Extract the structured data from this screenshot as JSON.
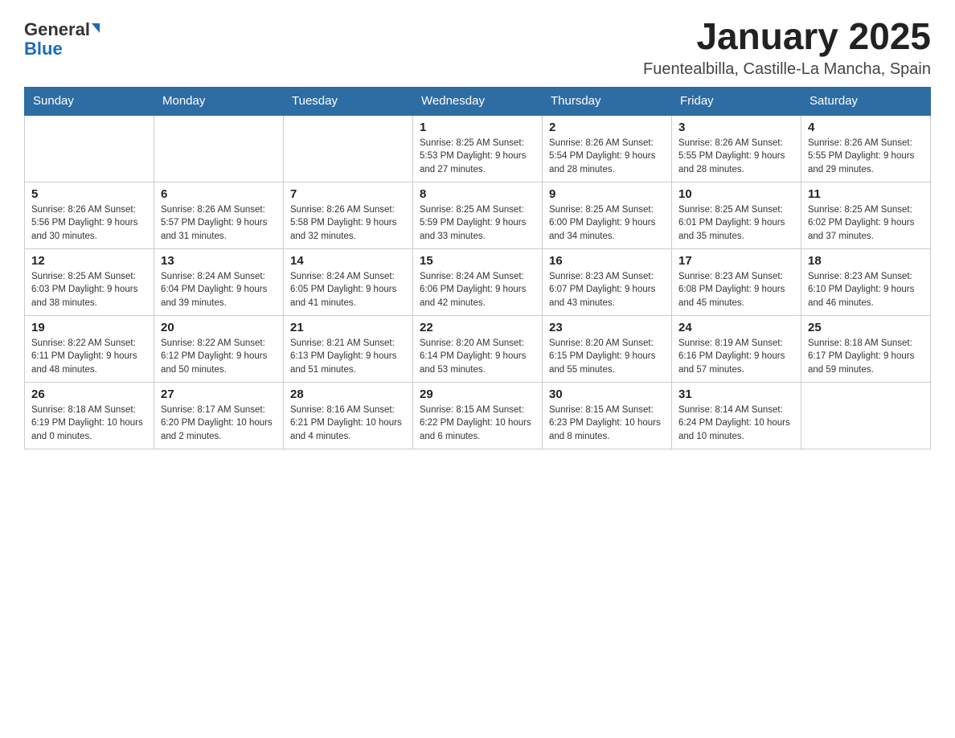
{
  "header": {
    "logo_text": "General",
    "logo_blue": "Blue",
    "title": "January 2025",
    "subtitle": "Fuentealbilla, Castille-La Mancha, Spain"
  },
  "days_of_week": [
    "Sunday",
    "Monday",
    "Tuesday",
    "Wednesday",
    "Thursday",
    "Friday",
    "Saturday"
  ],
  "weeks": [
    [
      {
        "day": "",
        "info": ""
      },
      {
        "day": "",
        "info": ""
      },
      {
        "day": "",
        "info": ""
      },
      {
        "day": "1",
        "info": "Sunrise: 8:25 AM\nSunset: 5:53 PM\nDaylight: 9 hours\nand 27 minutes."
      },
      {
        "day": "2",
        "info": "Sunrise: 8:26 AM\nSunset: 5:54 PM\nDaylight: 9 hours\nand 28 minutes."
      },
      {
        "day": "3",
        "info": "Sunrise: 8:26 AM\nSunset: 5:55 PM\nDaylight: 9 hours\nand 28 minutes."
      },
      {
        "day": "4",
        "info": "Sunrise: 8:26 AM\nSunset: 5:55 PM\nDaylight: 9 hours\nand 29 minutes."
      }
    ],
    [
      {
        "day": "5",
        "info": "Sunrise: 8:26 AM\nSunset: 5:56 PM\nDaylight: 9 hours\nand 30 minutes."
      },
      {
        "day": "6",
        "info": "Sunrise: 8:26 AM\nSunset: 5:57 PM\nDaylight: 9 hours\nand 31 minutes."
      },
      {
        "day": "7",
        "info": "Sunrise: 8:26 AM\nSunset: 5:58 PM\nDaylight: 9 hours\nand 32 minutes."
      },
      {
        "day": "8",
        "info": "Sunrise: 8:25 AM\nSunset: 5:59 PM\nDaylight: 9 hours\nand 33 minutes."
      },
      {
        "day": "9",
        "info": "Sunrise: 8:25 AM\nSunset: 6:00 PM\nDaylight: 9 hours\nand 34 minutes."
      },
      {
        "day": "10",
        "info": "Sunrise: 8:25 AM\nSunset: 6:01 PM\nDaylight: 9 hours\nand 35 minutes."
      },
      {
        "day": "11",
        "info": "Sunrise: 8:25 AM\nSunset: 6:02 PM\nDaylight: 9 hours\nand 37 minutes."
      }
    ],
    [
      {
        "day": "12",
        "info": "Sunrise: 8:25 AM\nSunset: 6:03 PM\nDaylight: 9 hours\nand 38 minutes."
      },
      {
        "day": "13",
        "info": "Sunrise: 8:24 AM\nSunset: 6:04 PM\nDaylight: 9 hours\nand 39 minutes."
      },
      {
        "day": "14",
        "info": "Sunrise: 8:24 AM\nSunset: 6:05 PM\nDaylight: 9 hours\nand 41 minutes."
      },
      {
        "day": "15",
        "info": "Sunrise: 8:24 AM\nSunset: 6:06 PM\nDaylight: 9 hours\nand 42 minutes."
      },
      {
        "day": "16",
        "info": "Sunrise: 8:23 AM\nSunset: 6:07 PM\nDaylight: 9 hours\nand 43 minutes."
      },
      {
        "day": "17",
        "info": "Sunrise: 8:23 AM\nSunset: 6:08 PM\nDaylight: 9 hours\nand 45 minutes."
      },
      {
        "day": "18",
        "info": "Sunrise: 8:23 AM\nSunset: 6:10 PM\nDaylight: 9 hours\nand 46 minutes."
      }
    ],
    [
      {
        "day": "19",
        "info": "Sunrise: 8:22 AM\nSunset: 6:11 PM\nDaylight: 9 hours\nand 48 minutes."
      },
      {
        "day": "20",
        "info": "Sunrise: 8:22 AM\nSunset: 6:12 PM\nDaylight: 9 hours\nand 50 minutes."
      },
      {
        "day": "21",
        "info": "Sunrise: 8:21 AM\nSunset: 6:13 PM\nDaylight: 9 hours\nand 51 minutes."
      },
      {
        "day": "22",
        "info": "Sunrise: 8:20 AM\nSunset: 6:14 PM\nDaylight: 9 hours\nand 53 minutes."
      },
      {
        "day": "23",
        "info": "Sunrise: 8:20 AM\nSunset: 6:15 PM\nDaylight: 9 hours\nand 55 minutes."
      },
      {
        "day": "24",
        "info": "Sunrise: 8:19 AM\nSunset: 6:16 PM\nDaylight: 9 hours\nand 57 minutes."
      },
      {
        "day": "25",
        "info": "Sunrise: 8:18 AM\nSunset: 6:17 PM\nDaylight: 9 hours\nand 59 minutes."
      }
    ],
    [
      {
        "day": "26",
        "info": "Sunrise: 8:18 AM\nSunset: 6:19 PM\nDaylight: 10 hours\nand 0 minutes."
      },
      {
        "day": "27",
        "info": "Sunrise: 8:17 AM\nSunset: 6:20 PM\nDaylight: 10 hours\nand 2 minutes."
      },
      {
        "day": "28",
        "info": "Sunrise: 8:16 AM\nSunset: 6:21 PM\nDaylight: 10 hours\nand 4 minutes."
      },
      {
        "day": "29",
        "info": "Sunrise: 8:15 AM\nSunset: 6:22 PM\nDaylight: 10 hours\nand 6 minutes."
      },
      {
        "day": "30",
        "info": "Sunrise: 8:15 AM\nSunset: 6:23 PM\nDaylight: 10 hours\nand 8 minutes."
      },
      {
        "day": "31",
        "info": "Sunrise: 8:14 AM\nSunset: 6:24 PM\nDaylight: 10 hours\nand 10 minutes."
      },
      {
        "day": "",
        "info": ""
      }
    ]
  ]
}
